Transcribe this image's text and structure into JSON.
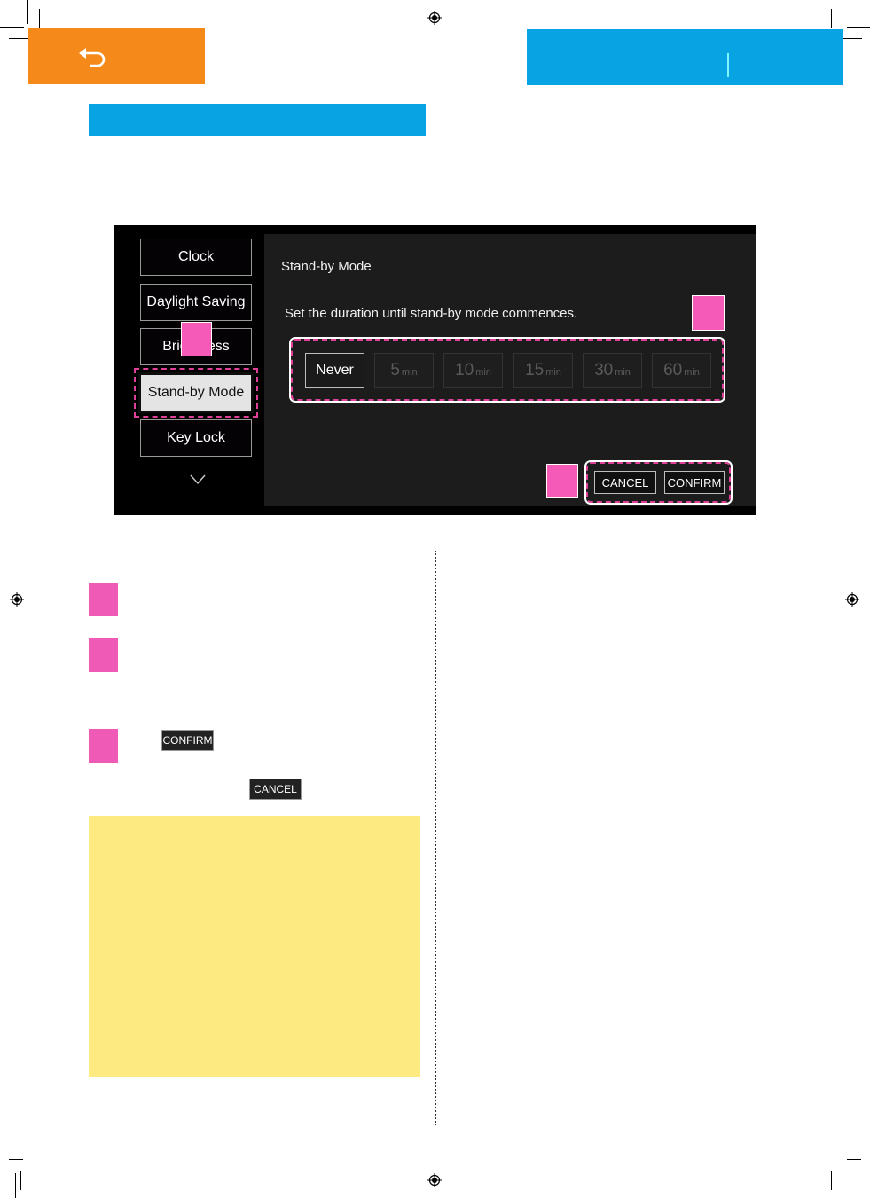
{
  "header": {
    "back_icon": "return-arrow-icon",
    "back_bar_color": "#f58a1a",
    "title_bar_color": "#07a3e3",
    "section_bar_color": "#07a3e3"
  },
  "screen": {
    "menu": {
      "items": [
        {
          "label": "Clock"
        },
        {
          "label": "Daylight Saving"
        },
        {
          "label": "Brightness",
          "label_visible_parts": [
            "Bri",
            "ess"
          ]
        },
        {
          "label": "Stand-by Mode",
          "active": true
        },
        {
          "label": "Key Lock"
        }
      ],
      "scroll_icon": "chevron-down-icon"
    },
    "panel": {
      "title": "Stand-by Mode",
      "description": "Set the duration until stand-by mode commences.",
      "options": [
        {
          "label": "Never",
          "value": "",
          "unit": "",
          "selected": true
        },
        {
          "label": "5 min",
          "value": "5",
          "unit": "min",
          "selected": false
        },
        {
          "label": "10 min",
          "value": "10",
          "unit": "min",
          "selected": false
        },
        {
          "label": "15 min",
          "value": "15",
          "unit": "min",
          "selected": false
        },
        {
          "label": "30 min",
          "value": "30",
          "unit": "min",
          "selected": false
        },
        {
          "label": "60 min",
          "value": "60",
          "unit": "min",
          "selected": false
        }
      ],
      "cancel_label": "CANCEL",
      "confirm_label": "CONFIRM"
    },
    "highlight_color": "#e0409a",
    "marker_color": "#f55ab8"
  },
  "instructions": {
    "inline_confirm_label": "CONFIRM",
    "inline_cancel_label": "CANCEL"
  },
  "note": {
    "background_color": "#fdea80"
  }
}
